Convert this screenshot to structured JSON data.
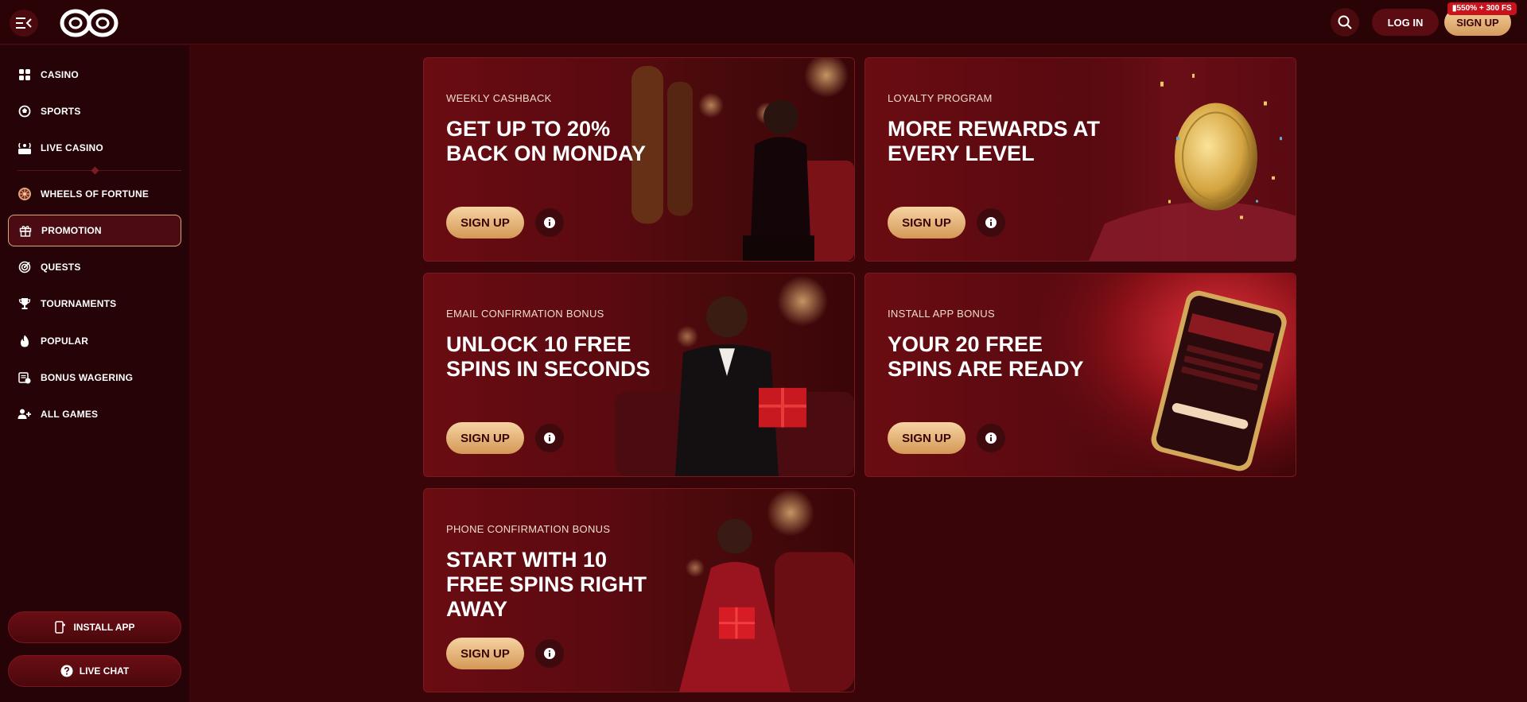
{
  "header": {
    "login_label": "LOG IN",
    "signup_label": "SIGN UP",
    "bonus_badge": "550% + 300 FS",
    "menu_icon": "menu-collapse-icon",
    "search_icon": "search-icon",
    "logo": "infinity-logo"
  },
  "sidebar": {
    "items": [
      {
        "label": "CASINO",
        "icon": "grid-icon"
      },
      {
        "label": "SPORTS",
        "icon": "ball-icon"
      },
      {
        "label": "LIVE CASINO",
        "icon": "live-icon"
      },
      {
        "label": "WHEELS OF FORTUNE",
        "icon": "wheel-icon"
      },
      {
        "label": "PROMOTION",
        "icon": "gift-icon",
        "active": true
      },
      {
        "label": "QUESTS",
        "icon": "target-icon"
      },
      {
        "label": "TOURNAMENTS",
        "icon": "trophy-icon"
      },
      {
        "label": "POPULAR",
        "icon": "flame-icon"
      },
      {
        "label": "BONUS WAGERING",
        "icon": "bonus-icon"
      },
      {
        "label": "ALL GAMES",
        "icon": "users-icon"
      }
    ],
    "install_app_label": "INSTALL APP",
    "live_chat_label": "LIVE CHAT"
  },
  "promotions": [
    {
      "kicker": "WEEKLY CASHBACK",
      "headline": "GET UP TO 20%\nBACK ON MONDAY",
      "button": "SIGN UP"
    },
    {
      "kicker": "LOYALTY PROGRAM",
      "headline": "MORE REWARDS AT\nEVERY LEVEL",
      "button": "SIGN UP"
    },
    {
      "kicker": "EMAIL CONFIRMATION BONUS",
      "headline": "UNLOCK 10 FREE\nSPINS IN SECONDS",
      "button": "SIGN UP"
    },
    {
      "kicker": "INSTALL APP BONUS",
      "headline": "YOUR 20 FREE\nSPINS ARE READY",
      "button": "SIGN UP"
    },
    {
      "kicker": "PHONE CONFIRMATION BONUS",
      "headline": "START WITH 10\nFREE SPINS RIGHT\nAWAY",
      "button": "SIGN UP"
    }
  ],
  "colors": {
    "background": "#3a0508",
    "sidebar": "#260306",
    "accent_gold": "#e6b47a",
    "card": "#5a0a10"
  }
}
